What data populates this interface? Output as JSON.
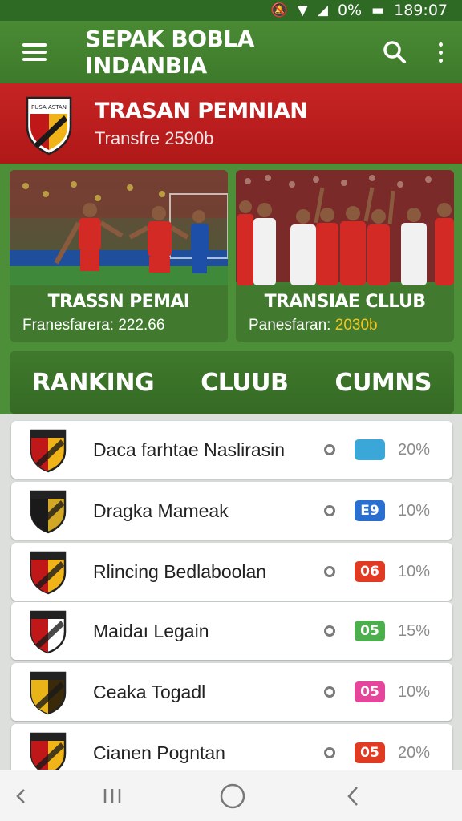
{
  "status_bar": {
    "time": "189:07",
    "battery_text": "0%"
  },
  "app_bar": {
    "title": "SEPAK BOBLA INDANBIA"
  },
  "banner": {
    "logo_text": "PUSA ASTAN",
    "title": "TRASAN PEMNIAN",
    "subtitle": "Transfre 2590b"
  },
  "news_cards": [
    {
      "title": "TRASSN PEMAI",
      "meta_label": "Franesfarera:",
      "meta_value": "222.66",
      "meta_value_color": "#ffffff"
    },
    {
      "title": "TRANSIAE CLLUB",
      "meta_label": "Panesfaran:",
      "meta_value": "2030b",
      "meta_value_color": "#f2c520"
    }
  ],
  "tabs": [
    "RANKING",
    "CLUUB",
    "CUMNS"
  ],
  "clubs": [
    {
      "name": "Daca farhtae Naslirasin",
      "badge": "",
      "badge_color": "#3ba6d8",
      "percent": "20%",
      "logo_primary": "#c01818",
      "logo_secondary": "#f0b419"
    },
    {
      "name": "Dragka Mameak",
      "badge": "E9",
      "badge_color": "#2a6fd0",
      "percent": "10%",
      "logo_primary": "#1a1a1a",
      "logo_secondary": "#d2a726"
    },
    {
      "name": "Rlincing Bedlaboolan",
      "badge": "06",
      "badge_color": "#e03a22",
      "percent": "10%",
      "logo_primary": "#c01818",
      "logo_secondary": "#f0b419"
    },
    {
      "name": "Maidaı Legain",
      "badge": "05",
      "badge_color": "#4cae4c",
      "percent": "15%",
      "logo_primary": "#c01818",
      "logo_secondary": "#ffffff"
    },
    {
      "name": "Ceaka Togadl",
      "badge": "05",
      "badge_color": "#e5459a",
      "percent": "10%",
      "logo_primary": "#e8b417",
      "logo_secondary": "#3a2a0a"
    },
    {
      "name": "Cianen Pogntan",
      "badge": "05",
      "badge_color": "#e03a22",
      "percent": "20%",
      "logo_primary": "#c01818",
      "logo_secondary": "#f0b419"
    }
  ],
  "colors": {
    "primary_green": "#3d7a2b",
    "banner_red": "#c62424"
  }
}
